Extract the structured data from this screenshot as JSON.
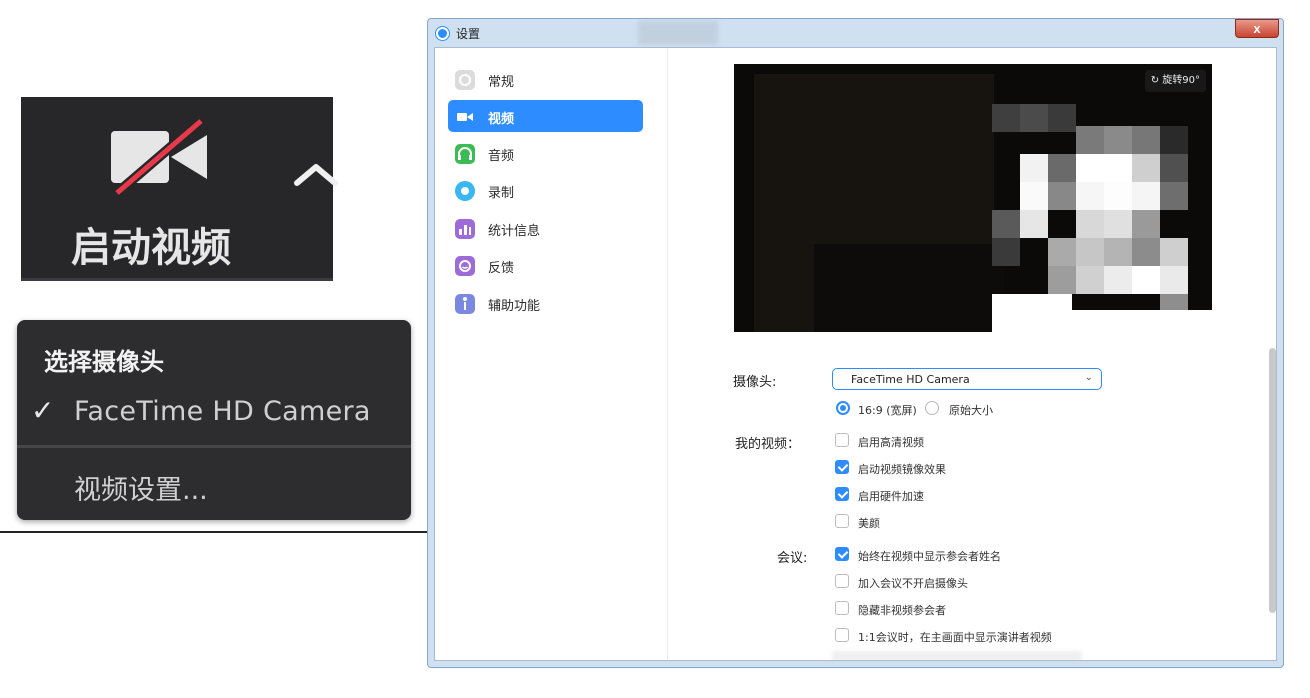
{
  "toolbar_button": {
    "label": "启动视频",
    "icons": [
      "video-off-icon",
      "caret-up-icon"
    ]
  },
  "camera_menu": {
    "title": "选择摄像头",
    "selected_camera": "FaceTime HD Camera",
    "settings_item": "视频设置..."
  },
  "window": {
    "title": "设置",
    "close_label": "x",
    "sidebar": [
      {
        "label": "常规",
        "icon": "gear-icon",
        "color": "#d9d9d9"
      },
      {
        "label": "视频",
        "icon": "video-icon",
        "color": "#2d8cff",
        "active": true
      },
      {
        "label": "音频",
        "icon": "headphones-icon",
        "color": "#3cba54"
      },
      {
        "label": "录制",
        "icon": "record-icon",
        "color": "#3ab7f0"
      },
      {
        "label": "统计信息",
        "icon": "stats-icon",
        "color": "#9e6ad8"
      },
      {
        "label": "反馈",
        "icon": "feedback-icon",
        "color": "#9e6ad8"
      },
      {
        "label": "辅助功能",
        "icon": "accessibility-icon",
        "color": "#7b88e0"
      }
    ],
    "video": {
      "rotate_label": "旋转90°",
      "camera_label": "摄像头:",
      "camera_value": "FaceTime HD Camera",
      "ratio_options": [
        {
          "label": "16:9 (宽屏)",
          "selected": true
        },
        {
          "label": "原始大小",
          "selected": false
        }
      ],
      "my_video_label": "我的视频：",
      "my_video_options": [
        {
          "label": "启用高清视频",
          "checked": false
        },
        {
          "label": "启动视频镜像效果",
          "checked": true
        },
        {
          "label": "启用硬件加速",
          "checked": true
        },
        {
          "label": "美颜",
          "checked": false
        }
      ],
      "meeting_label": "会议:",
      "meeting_options": [
        {
          "label": "始终在视频中显示参会者姓名",
          "checked": true
        },
        {
          "label": "加入会议不开启摄像头",
          "checked": false
        },
        {
          "label": "隐藏非视频参会者",
          "checked": false
        },
        {
          "label": "1:1会议时，在主画面中显示演讲者视频",
          "checked": false
        }
      ]
    }
  },
  "colors": {
    "accent": "#2d8cff",
    "dark_toolbar": "#27272a",
    "menu_bg": "#2d2d2f",
    "no_video_slash": "#e8394a"
  }
}
